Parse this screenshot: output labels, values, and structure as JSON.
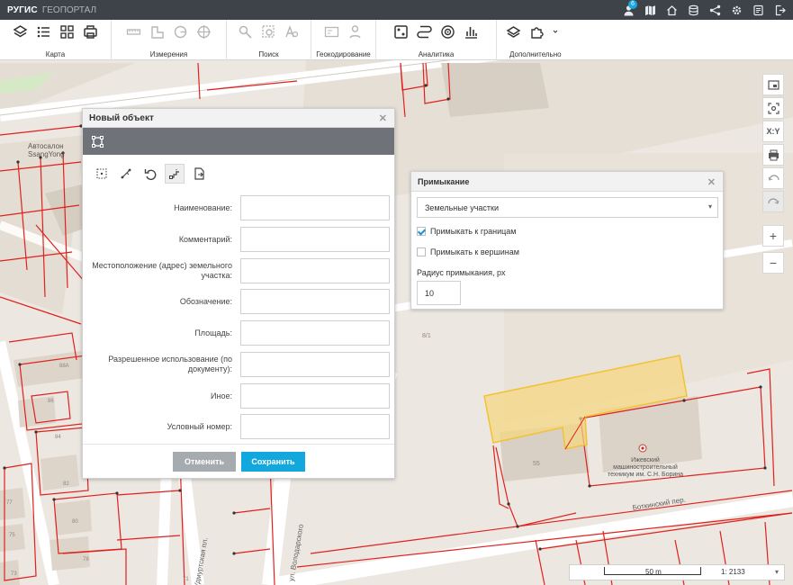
{
  "app": {
    "brand": "РУГИС",
    "subtitle": "ГЕОПОРТАЛ",
    "notification_count": "6"
  },
  "top_icons": [
    "user-icon",
    "map-book-icon",
    "home-icon",
    "database-icon",
    "share-icon",
    "gear-icon",
    "news-icon",
    "logout-icon"
  ],
  "ribbon": {
    "groups": [
      {
        "label": "Карта",
        "icons": [
          "layers-icon",
          "list-icon",
          "grid-icon",
          "print-icon"
        ]
      },
      {
        "label": "Измерения",
        "icons": [
          "ruler-icon",
          "area-icon",
          "angle-icon",
          "target-icon"
        ]
      },
      {
        "label": "Поиск",
        "icons": [
          "search-map-icon",
          "search-area-icon",
          "search-text-icon"
        ]
      },
      {
        "label": "Геокодирование",
        "icons": [
          "geocode-icon",
          "route-icon"
        ]
      },
      {
        "label": "Аналитика",
        "icons": [
          "analytics-grid-icon",
          "route-analysis-icon",
          "buffer-icon",
          "chart-icon"
        ]
      },
      {
        "label": "Дополнительно",
        "icons": [
          "layers-plus-icon",
          "puzzle-icon"
        ]
      }
    ]
  },
  "map": {
    "labels": {
      "autosalon": "Автосалон",
      "ssangyong": "SsangYong",
      "parcel_55": "55",
      "parcel_8_1": "8/1",
      "street_botkin": "Боткинский пер.",
      "street_volod": "ул. Володарского",
      "street_udm": "Удмуртская пл.",
      "school_name": "Ижевский машиностроительный техникум им. С.Н. Борина",
      "n88a": "88А",
      "n86": "86",
      "n84": "84",
      "n82": "82",
      "n80": "80",
      "n78": "78",
      "n77": "77",
      "n75": "75",
      "n73": "73",
      "n71": "71"
    },
    "colors": {
      "selected_fill": "#f6d77d",
      "selected_stroke": "#f3c232",
      "boundary": "#e0211d"
    },
    "scale": {
      "bar_label": "50 m",
      "ratio": "1: 2133"
    }
  },
  "new_object_dialog": {
    "title": "Новый объект",
    "tools": [
      "select-rect-icon",
      "edit-vertices-icon",
      "undo-icon",
      "snap-icon",
      "import-icon"
    ],
    "fields": [
      {
        "label": "Наименование:",
        "value": ""
      },
      {
        "label": "Комментарий:",
        "value": ""
      },
      {
        "label": "Местоположение (адрес) земельного участка:",
        "value": ""
      },
      {
        "label": "Обозначение:",
        "value": ""
      },
      {
        "label": "Площадь:",
        "value": ""
      },
      {
        "label": "Разрешенное использование (по документу):",
        "value": ""
      },
      {
        "label": "Иное:",
        "value": ""
      },
      {
        "label": "Условный номер:",
        "value": ""
      }
    ],
    "cancel_label": "Отменить",
    "save_label": "Сохранить"
  },
  "snap_panel": {
    "title": "Примыкание",
    "layer_select": "Земельные участки",
    "snap_to_borders": {
      "label": "Примыкать к границам",
      "checked": true
    },
    "snap_to_vertices": {
      "label": "Примыкать к вершинам",
      "checked": false
    },
    "radius_label": "Радиус примыкания, px",
    "radius_value": "10"
  },
  "map_controls": [
    "window-icon",
    "zoom-extent-icon",
    "coordinates-icon",
    "print-map-icon",
    "undo-map-icon",
    "redo-map-icon",
    "zoom-in-icon",
    "zoom-out-icon"
  ],
  "map_controls_text": {
    "coordinates": "X:Y",
    "zoom_in": "+",
    "zoom_out": "−"
  }
}
